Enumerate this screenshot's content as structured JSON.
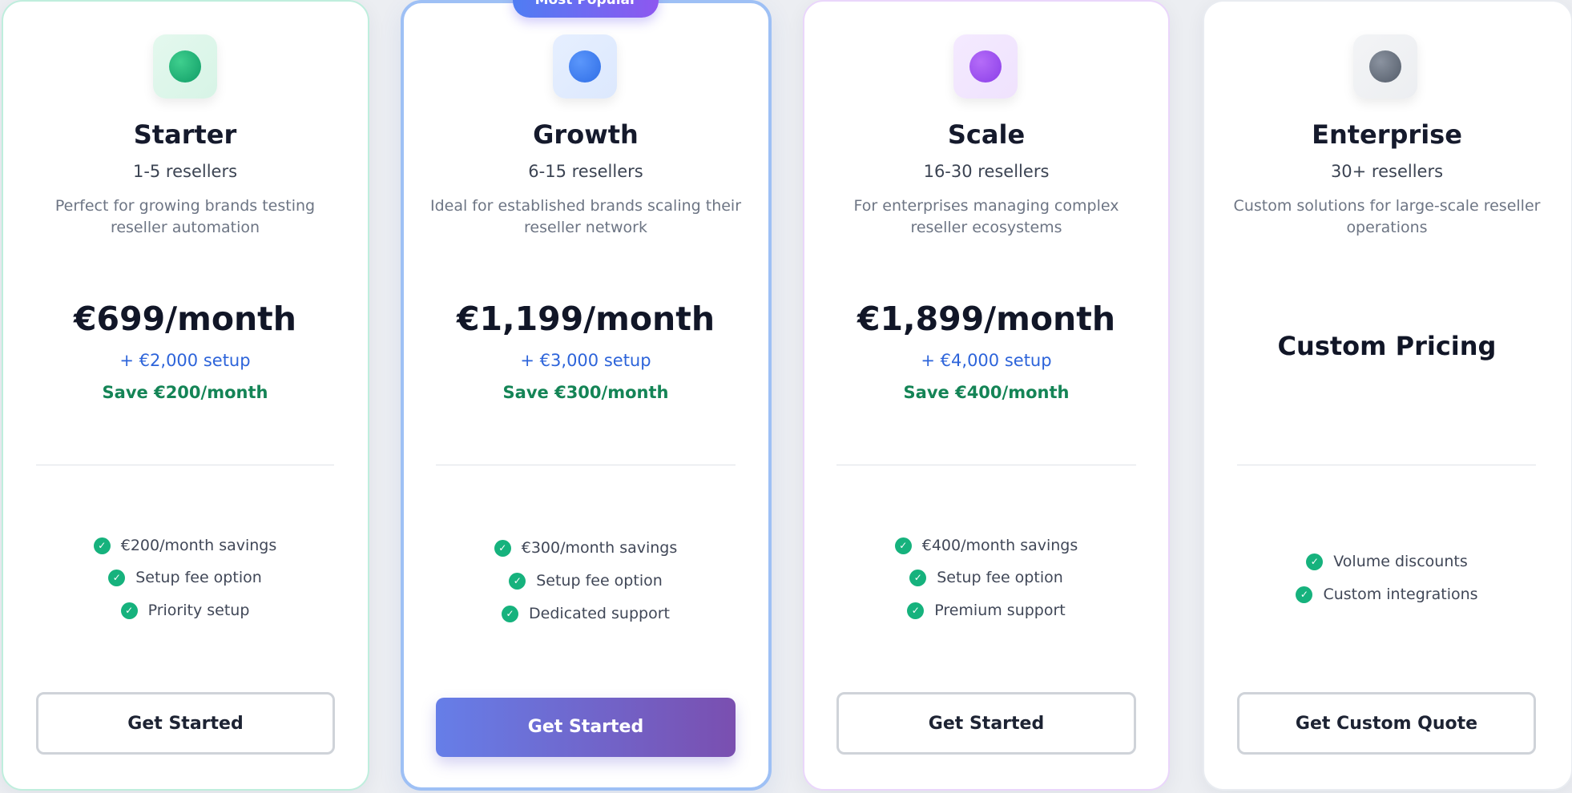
{
  "badge": "Most Popular",
  "colors": {
    "starter_accent": "#10b981",
    "growth_accent": "#3b82f6",
    "scale_accent": "#a855f7",
    "enterprise_accent": "#6b7280",
    "setup_text": "#2d64da",
    "savings_text": "#148456",
    "primary_button_gradient": [
      "#667ee8",
      "#7a4fb0"
    ]
  },
  "plans": [
    {
      "name": "Starter",
      "icon": "green-dot-icon",
      "resellers": "1-5 resellers",
      "description": "Perfect for growing brands testing reseller automation",
      "price": "€699/month",
      "setup": "+ €2,000 setup",
      "save": "Save €200/month",
      "features": [
        "€200/month savings",
        "Setup fee option",
        "Priority setup"
      ],
      "button": "Get Started"
    },
    {
      "name": "Growth",
      "icon": "blue-dot-icon",
      "resellers": "6-15 resellers",
      "description": "Ideal for established brands scaling their reseller network",
      "price": "€1,199/month",
      "setup": "+ €3,000 setup",
      "save": "Save €300/month",
      "features": [
        "€300/month savings",
        "Setup fee option",
        "Dedicated support"
      ],
      "button": "Get Started"
    },
    {
      "name": "Scale",
      "icon": "purple-dot-icon",
      "resellers": "16-30 resellers",
      "description": "For enterprises managing complex reseller ecosystems",
      "price": "€1,899/month",
      "setup": "+ €4,000 setup",
      "save": "Save €400/month",
      "features": [
        "€400/month savings",
        "Setup fee option",
        "Premium support"
      ],
      "button": "Get Started"
    },
    {
      "name": "Enterprise",
      "icon": "gray-dot-icon",
      "resellers": "30+ resellers",
      "description": "Custom solutions for large-scale reseller operations",
      "price": "Custom Pricing",
      "features": [
        "Volume discounts",
        "Custom integrations"
      ],
      "button": "Get Custom Quote"
    }
  ]
}
